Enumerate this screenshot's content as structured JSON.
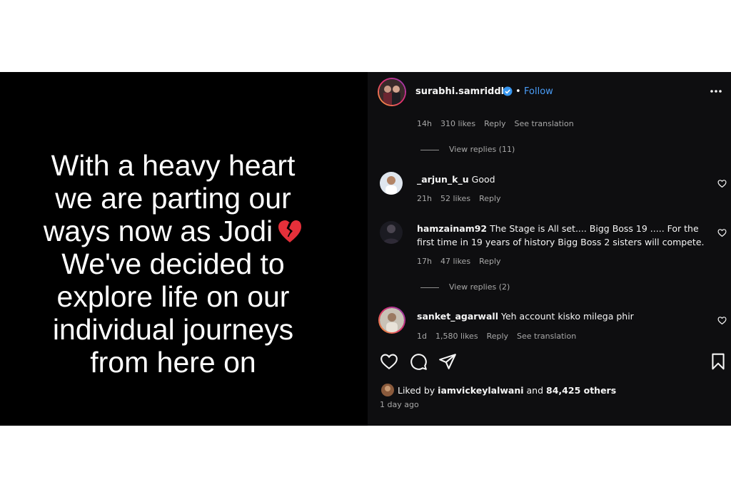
{
  "image": {
    "lines": [
      "With a heavy heart",
      "we are parting our",
      "ways now as Jodi",
      "We've decided to",
      "explore life on our",
      "individual journeys",
      "from here on"
    ],
    "emoji": "broken-heart-emoji"
  },
  "header": {
    "username": "surabhi.samriddhi",
    "verified_icon": "verified-badge-icon",
    "dot": "•",
    "follow_label": "Follow",
    "more_icon": "more-options-icon",
    "follow_color": "#4a9df8"
  },
  "comment0": {
    "time": "14h",
    "likes": "310 likes",
    "reply": "Reply",
    "translation": "See translation",
    "view_replies": "View replies (11)"
  },
  "comment1": {
    "username": "_arjun_k_u",
    "text": "Good",
    "time": "21h",
    "likes": "52 likes",
    "reply": "Reply"
  },
  "comment2": {
    "username": "hamzainam92",
    "text1": "The Stage is All set.... Bigg Boss 19 ..... For the",
    "text2": "first time in 19 years of history Bigg Boss 2 sisters will compete.",
    "time": "17h",
    "likes": "47 likes",
    "reply": "Reply",
    "view_replies": "View replies (2)"
  },
  "comment3": {
    "username": "sanket_agarwall",
    "text": "Yeh account kisko milega phir",
    "time": "1d",
    "likes": "1,580 likes",
    "reply": "Reply",
    "translation": "See translation"
  },
  "actions": {
    "like_icon": "heart-icon",
    "comment_icon": "comment-icon",
    "share_icon": "share-icon",
    "save_icon": "bookmark-icon"
  },
  "footer": {
    "liked_prefix": "Liked by",
    "liked_user": "iamvickeylalwani",
    "liked_and": "and",
    "liked_others": "84,425 others",
    "posted": "1 day ago"
  }
}
